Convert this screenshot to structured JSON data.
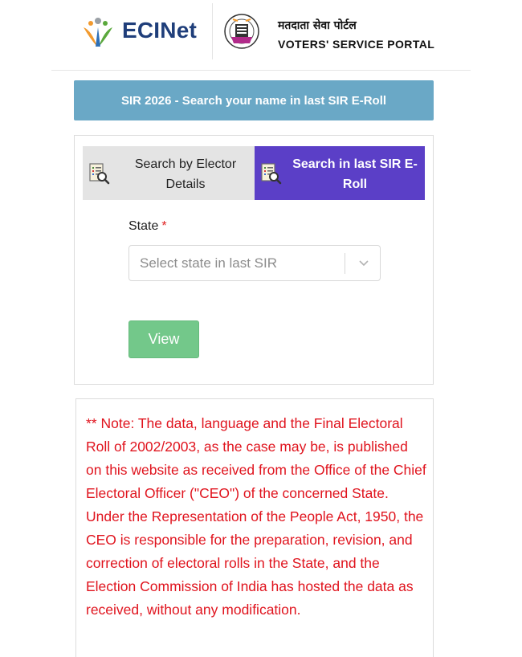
{
  "header": {
    "logo_text": "ECINet",
    "portal_hindi": "मतदाता सेवा पोर्टल",
    "portal_english": "VOTERS' SERVICE PORTAL"
  },
  "banner": {
    "text": "SIR 2026 - Search your name in last SIR E-Roll"
  },
  "tabs": [
    {
      "label": "Search by Elector Details",
      "icon": "document-search-icon",
      "active": false
    },
    {
      "label": "Search in last SIR E-Roll",
      "icon": "document-search-icon",
      "active": true
    }
  ],
  "form": {
    "state_label": "State",
    "required_marker": "*",
    "state_placeholder": "Select state in last SIR",
    "view_label": "View"
  },
  "note": {
    "text": "** Note: The data, language and the Final Electoral Roll of 2002/2003, as the case may be, is published on this website as received from the Office of the Chief Electoral Officer (\"CEO\") of the concerned State. Under the Representation of the People Act, 1950, the CEO is responsible for the preparation, revision, and correction of electoral rolls in the State, and the Election Commission of India has hosted the data as received, without any modification."
  },
  "colors": {
    "banner": "#6aa8c6",
    "active_tab": "#5b3fc7",
    "inactive_tab": "#e4e4e4",
    "view_button": "#73c88a",
    "note_text": "#e0141e",
    "logo_text": "#1f3e7a"
  }
}
